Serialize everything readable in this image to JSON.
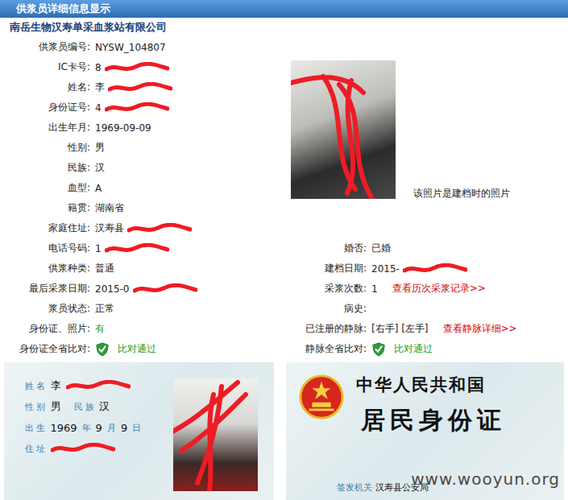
{
  "header": {
    "title": "供浆员详细信息显示"
  },
  "org_name": "南岳生物汉寿单采血浆站有限公司",
  "left_fields": [
    {
      "label": "供浆员编号:",
      "value": "NYSW_104807",
      "redacted": false,
      "kind": "text"
    },
    {
      "label": "IC卡号:",
      "value": "8",
      "redacted": true,
      "kind": "text"
    },
    {
      "label": "姓名:",
      "value": "李",
      "redacted": true,
      "kind": "text"
    },
    {
      "label": "身份证号:",
      "value": "4",
      "redacted": true,
      "kind": "text"
    },
    {
      "label": "出生年月:",
      "value": "1969-09-09",
      "redacted": false,
      "kind": "text"
    },
    {
      "label": "性别:",
      "value": "男",
      "redacted": false,
      "kind": "text"
    },
    {
      "label": "民族:",
      "value": "汉",
      "redacted": false,
      "kind": "text"
    },
    {
      "label": "血型:",
      "value": "A",
      "redacted": false,
      "kind": "text"
    },
    {
      "label": "籍贯:",
      "value": "湖南省",
      "redacted": false,
      "kind": "text"
    },
    {
      "label": "家庭住址:",
      "value": "汉寿县",
      "redacted": true,
      "kind": "text"
    },
    {
      "label": "电话号码:",
      "value": "1",
      "redacted": true,
      "kind": "text"
    },
    {
      "label": "供浆种类:",
      "value": "普通",
      "redacted": false,
      "kind": "text"
    },
    {
      "label": "最后采浆日期:",
      "value": "2015-0",
      "redacted": true,
      "kind": "text"
    },
    {
      "label": "浆员状态:",
      "value": "正常",
      "redacted": false,
      "kind": "text"
    },
    {
      "label": "身份证、照片:",
      "value": "有",
      "redacted": false,
      "kind": "green"
    },
    {
      "label": "身份证全省比对:",
      "value": "比对通过",
      "redacted": false,
      "kind": "check"
    }
  ],
  "photo": {
    "caption": "该照片是建档时的照片",
    "redacted": true
  },
  "right_fields": [
    {
      "label": "婚否:",
      "value": "已婚",
      "redacted": false,
      "kind": "text",
      "link": ""
    },
    {
      "label": "建档日期:",
      "value": "2015-",
      "redacted": true,
      "kind": "text",
      "link": ""
    },
    {
      "label": "采浆次数:",
      "value": "1",
      "redacted": false,
      "kind": "text",
      "link": "查看历次采浆记录>>"
    },
    {
      "label": "病史:",
      "value": "",
      "redacted": false,
      "kind": "text",
      "link": ""
    },
    {
      "label": "已注册的静脉:",
      "value": "[右手] [左手]",
      "redacted": false,
      "kind": "text",
      "link": "查看静脉详细>>"
    },
    {
      "label": "静脉全省比对:",
      "value": "比对通过",
      "redacted": false,
      "kind": "check",
      "link": ""
    }
  ],
  "id_front": {
    "name": {
      "label": "姓 名",
      "value": "李",
      "redacted": true
    },
    "sex": {
      "label": "性 别",
      "value": "男"
    },
    "ethnicity": {
      "label": "民 族",
      "value": "汉"
    },
    "birth": {
      "label": "出 生",
      "parts": [
        "1969",
        "年",
        "9",
        "月",
        "9",
        "日"
      ]
    },
    "address": {
      "label": "住 址",
      "redacted": true
    },
    "photo_redacted": true
  },
  "id_back": {
    "country": "中华人民共和国",
    "title": "居民身份证",
    "authority_label": "签发机关",
    "authority": "汉寿县公安局"
  },
  "watermark": "www.wooyun.org"
}
